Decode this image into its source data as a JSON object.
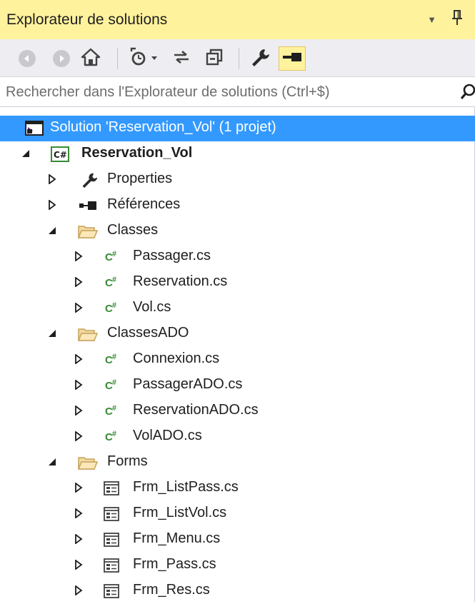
{
  "panel": {
    "title": "Explorateur de solutions",
    "title_dropdown_icon": "chevron-down-icon",
    "pin_icon": "pin-icon"
  },
  "toolbar": {
    "buttons": [
      {
        "name": "back-button",
        "icon": "arrow-left-circle-icon",
        "enabled": false
      },
      {
        "name": "forward-button",
        "icon": "arrow-right-circle-icon",
        "enabled": false
      },
      {
        "name": "home-button",
        "icon": "home-icon",
        "enabled": true
      },
      {
        "name": "pending-changes-filter-button",
        "icon": "clock-filter-icon",
        "enabled": true
      },
      {
        "name": "sync-button",
        "icon": "sync-arrows-icon",
        "enabled": true
      },
      {
        "name": "collapse-all-button",
        "icon": "collapse-all-icon",
        "enabled": true
      },
      {
        "name": "properties-button",
        "icon": "wrench-icon",
        "enabled": true
      },
      {
        "name": "preview-button",
        "icon": "preview-selected-icon",
        "enabled": true,
        "active": true
      }
    ]
  },
  "search": {
    "placeholder": "Rechercher dans l'Explorateur de solutions (Ctrl+$)",
    "icon": "search-icon"
  },
  "tree": {
    "solution": "Solution 'Reservation_Vol' (1 projet)",
    "project": "Reservation_Vol",
    "properties": "Properties",
    "references": "Références",
    "folders": [
      {
        "name": "Classes",
        "files": [
          "Passager.cs",
          "Reservation.cs",
          "Vol.cs"
        ],
        "file_icon": "csharp-file-icon"
      },
      {
        "name": "ClassesADO",
        "files": [
          "Connexion.cs",
          "PassagerADO.cs",
          "ReservationADO.cs",
          "VolADO.cs"
        ],
        "file_icon": "csharp-file-icon"
      },
      {
        "name": "Forms",
        "files": [
          "Frm_ListPass.cs",
          "Frm_ListVol.cs",
          "Frm_Menu.cs",
          "Frm_Pass.cs",
          "Frm_Res.cs"
        ],
        "file_icon": "form-file-icon"
      }
    ]
  },
  "colors": {
    "title_bg": "#fff29d",
    "toolbar_bg": "#eeeef2",
    "selection": "#3399ff",
    "csharp_green": "#388a34",
    "folder": "#dcb67a"
  }
}
